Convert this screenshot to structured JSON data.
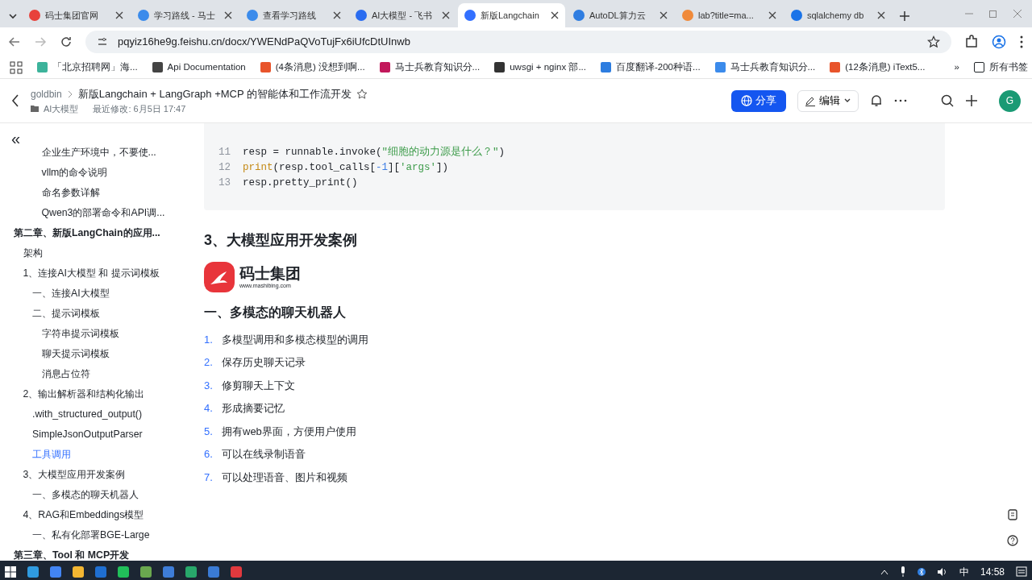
{
  "browser": {
    "tabs": [
      {
        "title": "码士集团官网",
        "selected": false
      },
      {
        "title": "学习路线 - 马士",
        "selected": false
      },
      {
        "title": "查看学习路线",
        "selected": false
      },
      {
        "title": "AI大模型 - 飞书",
        "selected": false
      },
      {
        "title": "新版Langchain",
        "selected": true
      },
      {
        "title": "AutoDL算力云",
        "selected": false
      },
      {
        "title": "lab?title=ma...",
        "selected": false
      },
      {
        "title": "sqlalchemy db",
        "selected": false
      }
    ],
    "url": "pqyiz16he9g.feishu.cn/docx/YWENdPaQVoTujFx6iUfcDtUInwb",
    "bookmarks": [
      {
        "label": "「北京招聘网」海..."
      },
      {
        "label": "Api Documentation"
      },
      {
        "label": "(4条消息) 没想到啊..."
      },
      {
        "label": "马士兵教育知识分..."
      },
      {
        "label": "uwsgi + nginx 部..."
      },
      {
        "label": "百度翻译-200种语..."
      },
      {
        "label": "马士兵教育知识分..."
      },
      {
        "label": "(12条消息) iText5..."
      }
    ],
    "more": "»",
    "folder": "所有书签"
  },
  "doc": {
    "breadcrumb": "goldbin",
    "title": "新版Langchain + LangGraph +MCP 的智能体和工作流开发",
    "folder": "AI大模型",
    "modified": "最近修改: 6月5日 17:47",
    "share": "分享",
    "edit": "编辑",
    "avatar": "G"
  },
  "sidebar": {
    "collapse": "«",
    "partial_items": [
      {
        "label": "企业生产环境中，不要使...",
        "selected": false
      },
      {
        "label": "vllm的命令说明",
        "selected": false
      },
      {
        "label": "命名参数详解",
        "selected": false
      },
      {
        "label": "Qwen3的部署命令和API调...",
        "selected": false
      }
    ],
    "items": [
      {
        "label": "第二章、新版LangChain的应用...",
        "selected": false,
        "children": [
          {
            "label": "架构",
            "selected": false
          },
          {
            "label": "1、连接AI大模型 和 提示词模板",
            "selected": false,
            "children": [
              {
                "label": "一、连接AI大模型",
                "selected": false
              },
              {
                "label": "二、提示词模板",
                "selected": false,
                "children": [
                  {
                    "label": "字符串提示词模板",
                    "selected": false
                  },
                  {
                    "label": "聊天提示词模板",
                    "selected": false
                  },
                  {
                    "label": "消息占位符",
                    "selected": false
                  }
                ]
              }
            ]
          },
          {
            "label": "2、输出解析器和结构化输出",
            "selected": false,
            "children": [
              {
                "label": ".with_structured_output()",
                "selected": false
              },
              {
                "label": "SimpleJsonOutputParser",
                "selected": false
              },
              {
                "label": "工具调用",
                "selected": true
              }
            ]
          },
          {
            "label": "3、大模型应用开发案例",
            "selected": false,
            "children": [
              {
                "label": "一、多模态的聊天机器人",
                "selected": false
              }
            ]
          },
          {
            "label": "4、RAG和Embeddings模型",
            "selected": false,
            "children": [
              {
                "label": "一、私有化部署BGE-Large",
                "selected": false
              }
            ]
          }
        ]
      },
      {
        "label": "第三章、Tool 和 MCP开发",
        "selected": false
      }
    ]
  },
  "code": [
    {
      "num": "11",
      "tokens": [
        {
          "text": "resp = runnable.invoke(",
          "kind": "plain"
        },
        {
          "text": "\"细胞的动力源是什么？\"",
          "kind": "string"
        },
        {
          "text": ")",
          "kind": "plain"
        }
      ]
    },
    {
      "num": "12",
      "tokens": [
        {
          "text": "print",
          "kind": "builtin"
        },
        {
          "text": "(resp.tool_calls[",
          "kind": "plain"
        },
        {
          "text": "-1",
          "kind": "number"
        },
        {
          "text": "][",
          "kind": "plain"
        },
        {
          "text": "'args'",
          "kind": "string"
        },
        {
          "text": "])",
          "kind": "plain"
        }
      ]
    },
    {
      "num": "13",
      "tokens": [
        {
          "text": "resp.pretty_print()",
          "kind": "plain"
        }
      ]
    }
  ],
  "heading": "3、大模型应用开发案例",
  "logo": {
    "name": "码士集团",
    "site": "www.mashibing.com"
  },
  "subheading": "一、多模态的聊天机器人",
  "list": [
    {
      "num": "1.",
      "text": "多模型调用和多模态模型的调用"
    },
    {
      "num": "2.",
      "text": "保存历史聊天记录"
    },
    {
      "num": "3.",
      "text": "修剪聊天上下文"
    },
    {
      "num": "4.",
      "text": "形成摘要记忆"
    },
    {
      "num": "5.",
      "text": "拥有web界面，方便用户使用"
    },
    {
      "num": "6.",
      "text": "可以在线录制语音"
    },
    {
      "num": "7.",
      "text": "可以处理语音、图片和视频"
    }
  ],
  "taskbar": {
    "ime": "中",
    "time": "14:58"
  }
}
